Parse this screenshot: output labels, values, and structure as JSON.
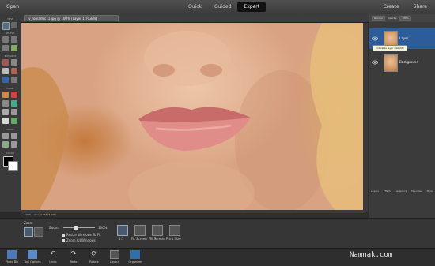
{
  "top_bar": {
    "open_label": "Open",
    "modes": [
      "Quick",
      "Guided",
      "Expert"
    ],
    "active_mode": "Expert",
    "right_actions": [
      "Create",
      "Share"
    ]
  },
  "document": {
    "tab_title": "lv_romantic11.jpg @ 100% (Layer 1, RGB/8)"
  },
  "toolbox": {
    "sections": [
      "VIEW",
      "SELECT",
      "ENHANCE",
      "DRAW",
      "MODIFY",
      "COLOR"
    ]
  },
  "status": {
    "zoom": "100%",
    "doc_info": "Doc: 2.25M/4.50M"
  },
  "layers_panel": {
    "blend_mode": "Normal",
    "opacity_label": "Opacity:",
    "opacity_value": "100%",
    "layers": [
      {
        "name": "Layer 1"
      },
      {
        "name": "Background"
      }
    ],
    "tooltip": "Indicates layer visibility",
    "footer": [
      "Layers",
      "Effects",
      "Graphics",
      "Favorites",
      "More"
    ]
  },
  "tool_options": {
    "section_label": "Zoom",
    "zoom_label": "Zoom:",
    "zoom_value": "100%",
    "checkbox_resize": "Resize Windows To Fit",
    "checkbox_zoom_all": "Zoom All Windows",
    "view_buttons": [
      "1:1",
      "Fit Screen",
      "Fill Screen",
      "Print Size"
    ]
  },
  "bottom_bar": {
    "items": [
      "Photo Bin",
      "Tool Options",
      "Undo",
      "Redo",
      "Rotate",
      "Layout",
      "Organizer"
    ]
  },
  "watermark": "Namnak.com",
  "colors": {
    "accent_selected": "#2d5d99",
    "active_mode_bg": "#111111"
  }
}
